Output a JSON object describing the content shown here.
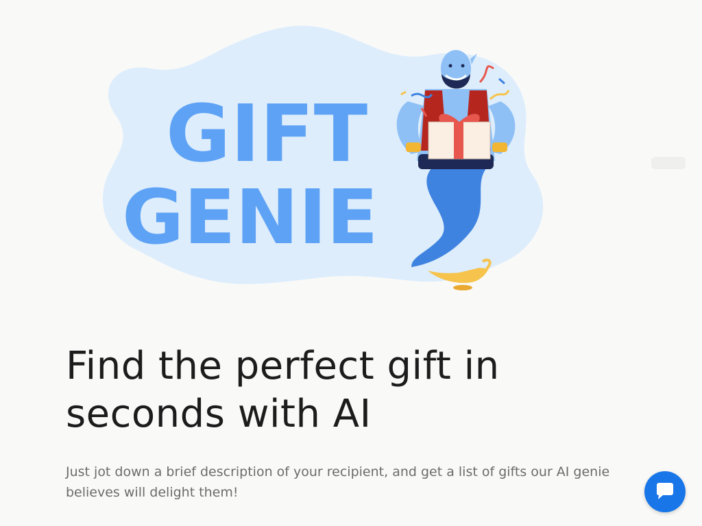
{
  "hero": {
    "logo_line1": "GIFT",
    "logo_line2": "GENIE"
  },
  "headline": "Find the perfect gift in seconds with AI",
  "subtext": "Just jot down a brief description of your recipient, and get a list of gifts our AI genie believes will delight them!",
  "chat": {
    "icon": "chat-bubble-icon"
  },
  "colors": {
    "page_background": "#f9f9f8",
    "logo_blue": "#5ea2f5",
    "cloud": "#ddedfc",
    "genie_skin": "#8ec0f6",
    "chat_button": "#1976e8"
  }
}
